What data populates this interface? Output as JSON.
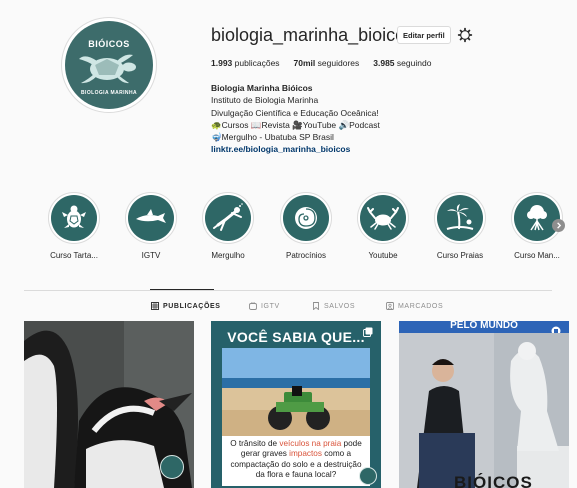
{
  "profile": {
    "username": "biologia_marinha_bioicos",
    "edit_label": "Editar perfil",
    "avatar_brand": "BIÓICOS",
    "avatar_arc_text": "BIOLOGIA MARINHA",
    "stats": {
      "posts_count": "1.993",
      "posts_label": "publicações",
      "followers_count": "70mil",
      "followers_label": "seguidores",
      "following_count": "3.985",
      "following_label": "seguindo"
    },
    "bio": {
      "name": "Biologia Marinha Bióicos",
      "line1": "Instituto de Biologia Marinha",
      "line2": "Divulgação Científica e Educação Oceânica!",
      "line3": "Cursos 📖Revista 🎥YouTube 🔊Podcast",
      "line3_lead_icon": "🐢",
      "line4": "Mergulho - Ubatuba SP Brasil",
      "line4_lead_icon": "🤿",
      "link": "linktr.ee/biologia_marinha_bioicos"
    }
  },
  "highlights": [
    {
      "label": "Curso Tarta...",
      "icon": "turtle-icon"
    },
    {
      "label": "IGTV",
      "icon": "shark-icon"
    },
    {
      "label": "Mergulho",
      "icon": "diver-icon"
    },
    {
      "label": "Patrocínios",
      "icon": "nautilus-icon"
    },
    {
      "label": "Youtube",
      "icon": "crab-icon"
    },
    {
      "label": "Curso Praias",
      "icon": "palm-beach-icon"
    },
    {
      "label": "Curso Man...",
      "icon": "mangrove-tree-icon"
    }
  ],
  "tabs": [
    {
      "label": "PUBLICAÇÕES",
      "icon": "grid-icon",
      "active": true
    },
    {
      "label": "IGTV",
      "icon": "igtv-icon",
      "active": false
    },
    {
      "label": "SALVOS",
      "icon": "bookmark-icon",
      "active": false
    },
    {
      "label": "MARCADOS",
      "icon": "tagged-icon",
      "active": false
    }
  ],
  "posts": [
    {
      "subject": "penguins",
      "badge": "BIÓICOS"
    },
    {
      "headline": "VOCÊ SABIA QUE...",
      "caption_part1": "O trânsito de ",
      "caption_hl1": "veículos na praia",
      "caption_part2": " pode gerar graves ",
      "caption_hl2": "impactos",
      "caption_part3": " como a compactação do solo e a destruição da flora e fauna local?"
    },
    {
      "top_text": "PELO MUNDO",
      "bottom_text": "BIÓICOS"
    }
  ],
  "colors": {
    "brand_teal": "#2e6766",
    "link_blue": "#00376b",
    "highlight_orange": "#d9533a"
  }
}
